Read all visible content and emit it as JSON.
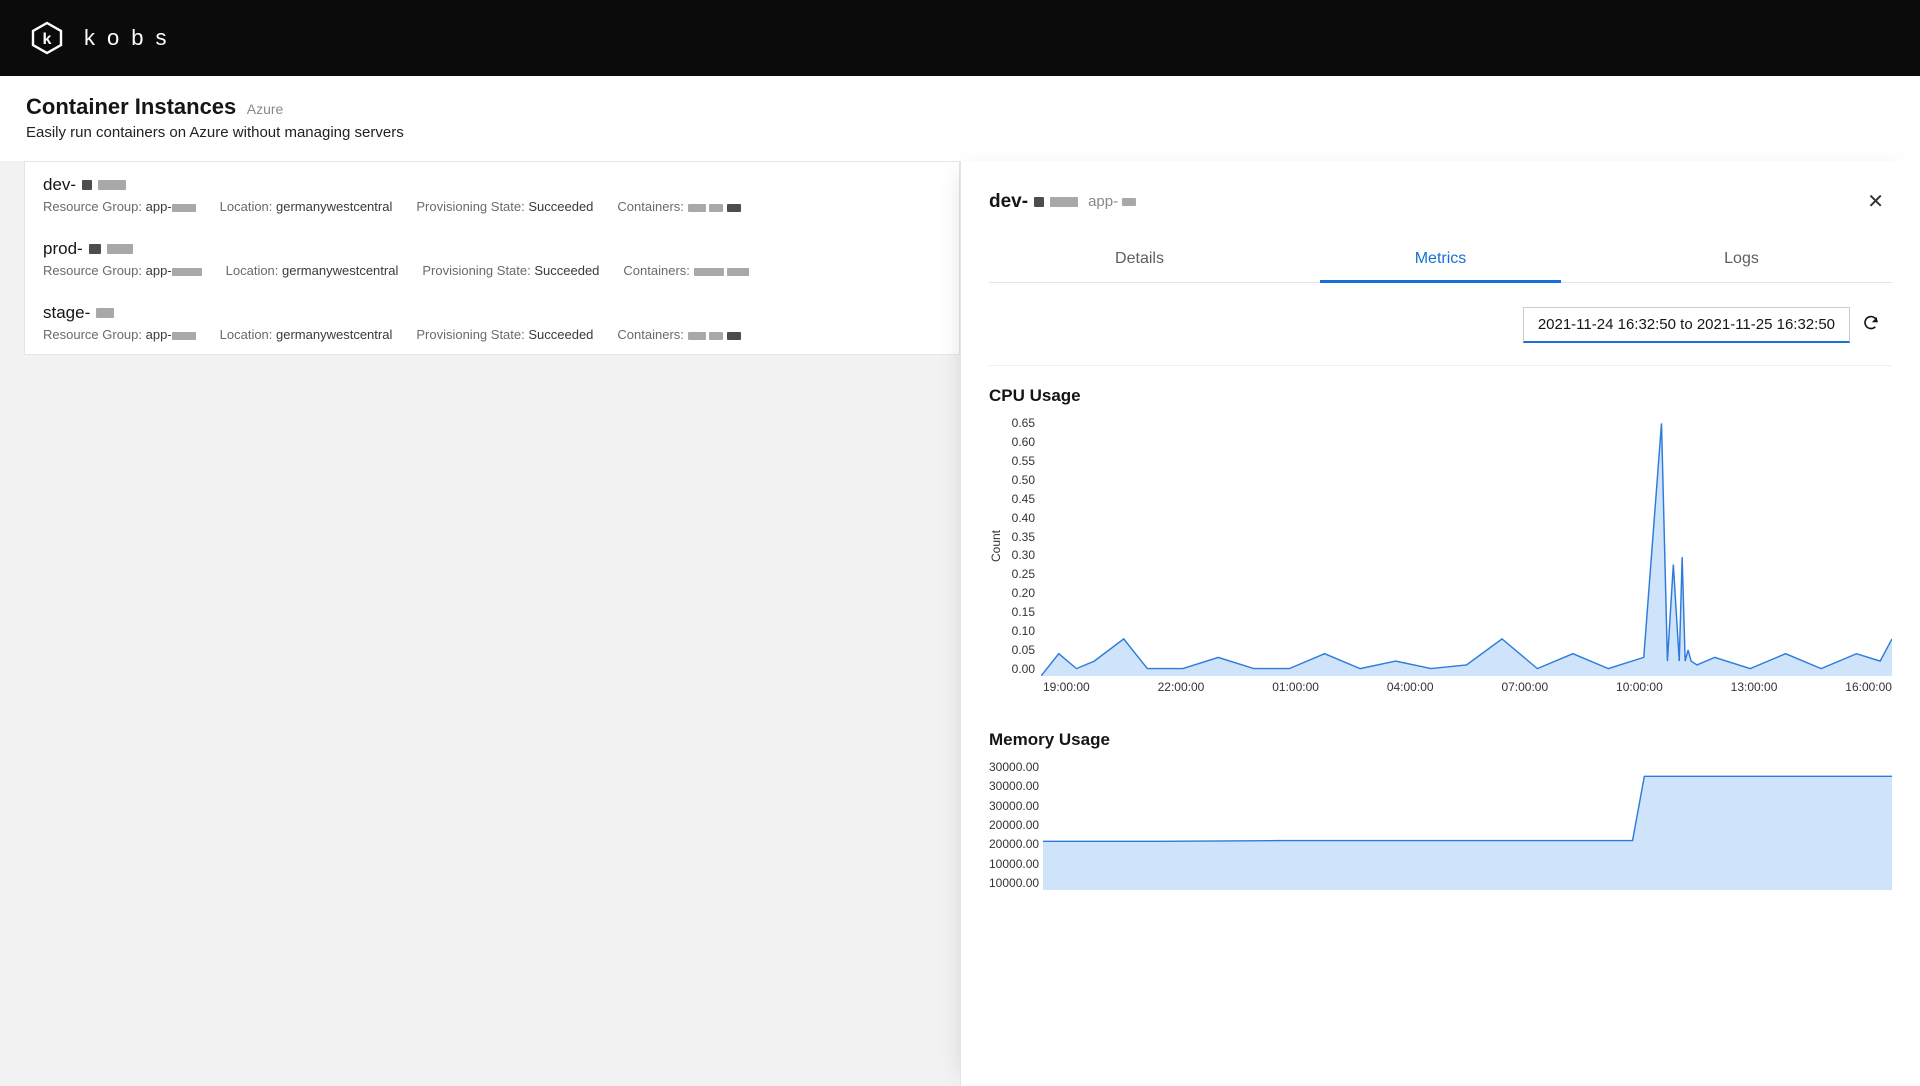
{
  "brand": {
    "name": "kobs"
  },
  "page": {
    "title": "Container Instances",
    "provider": "Azure",
    "subtitle": "Easily run containers on Azure without managing servers"
  },
  "list": {
    "items": [
      {
        "name_prefix": "dev-",
        "resource_group_prefix": "app-",
        "location": "germanywestcentral",
        "provisioning_state": "Succeeded",
        "containers_prefix": ""
      },
      {
        "name_prefix": "prod-",
        "resource_group_prefix": "app-",
        "location": "germanywestcentral",
        "provisioning_state": "Succeeded",
        "containers_prefix": ""
      },
      {
        "name_prefix": "stage-",
        "resource_group_prefix": "app-",
        "location": "germanywestcentral",
        "provisioning_state": "Succeeded",
        "containers_prefix": ""
      }
    ],
    "labels": {
      "resource_group": "Resource Group: ",
      "location": "Location: ",
      "provisioning_state": "Provisioning State: ",
      "containers": "Containers: "
    }
  },
  "panel": {
    "title_prefix": "dev-",
    "sub_prefix": "app-",
    "tabs": {
      "details": "Details",
      "metrics": "Metrics",
      "logs": "Logs"
    },
    "time_range": "2021-11-24 16:32:50 to 2021-11-25 16:32:50",
    "cpu_title": "CPU Usage",
    "mem_title": "Memory Usage"
  },
  "chart_data": [
    {
      "type": "line",
      "title": "CPU Usage",
      "xlabel": "",
      "ylabel": "Count",
      "ylim": [
        0.0,
        0.7
      ],
      "y_ticks": [
        "0.65",
        "0.60",
        "0.55",
        "0.50",
        "0.45",
        "0.40",
        "0.35",
        "0.30",
        "0.25",
        "0.20",
        "0.15",
        "0.10",
        "0.05",
        "0.00"
      ],
      "x_ticks": [
        "19:00:00",
        "22:00:00",
        "01:00:00",
        "04:00:00",
        "07:00:00",
        "10:00:00",
        "13:00:00",
        "16:00:00"
      ],
      "series": [
        {
          "name": "cpu",
          "x_minutes": [
            0,
            30,
            60,
            90,
            140,
            180,
            240,
            300,
            360,
            420,
            480,
            540,
            600,
            660,
            720,
            780,
            840,
            900,
            960,
            1020,
            1050,
            1060,
            1070,
            1080,
            1085,
            1090,
            1095,
            1100,
            1110,
            1140,
            1200,
            1260,
            1320,
            1380,
            1420,
            1440
          ],
          "values": [
            0,
            0.06,
            0.02,
            0.04,
            0.1,
            0.02,
            0.02,
            0.05,
            0.02,
            0.02,
            0.06,
            0.02,
            0.04,
            0.02,
            0.03,
            0.1,
            0.02,
            0.06,
            0.02,
            0.05,
            0.68,
            0.04,
            0.3,
            0.04,
            0.32,
            0.04,
            0.07,
            0.04,
            0.03,
            0.05,
            0.02,
            0.06,
            0.02,
            0.06,
            0.04,
            0.1
          ]
        }
      ]
    },
    {
      "type": "area",
      "title": "Memory Usage",
      "xlabel": "",
      "ylabel": "",
      "ylim": [
        0,
        40000
      ],
      "y_ticks": [
        "30000.00",
        "30000.00",
        "30000.00",
        "20000.00",
        "20000.00",
        "10000.00",
        "10000.00"
      ],
      "x_ticks": [],
      "series": [
        {
          "name": "memory",
          "x_minutes": [
            0,
            200,
            400,
            600,
            800,
            1000,
            1020,
            1040,
            1060,
            1440
          ],
          "values": [
            15000,
            15000,
            15200,
            15200,
            15200,
            15200,
            35000,
            35000,
            35000,
            35000
          ]
        }
      ]
    }
  ]
}
